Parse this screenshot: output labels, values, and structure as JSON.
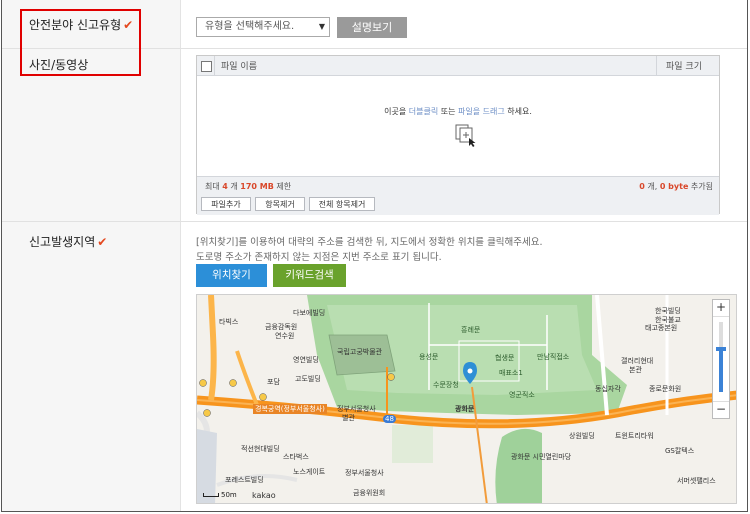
{
  "sections": {
    "category_label": "안전분야 신고유형",
    "media_label": "사진/동영상",
    "location_label": "신고발생지역",
    "required_mark": "✔"
  },
  "category": {
    "select_placeholder": "유형을 선택해주세요.",
    "explain_button": "설명보기"
  },
  "upload": {
    "col_filename": "파일 이름",
    "col_filesize": "파일 크기",
    "drop_text_prefix": "이곳을 ",
    "drop_link1": "더블클릭",
    "drop_mid": " 또는 ",
    "drop_link2": "파일을 드래그",
    "drop_suffix": " 하세요.",
    "limit_prefix": "최대 ",
    "limit_count": "4",
    "limit_mid": " 개 ",
    "limit_size": "170 MB",
    "limit_suffix": " 제한",
    "total_count": "0",
    "total_mid": " 개, ",
    "total_size": "0 byte",
    "total_suffix": " 추가됨",
    "buttons": [
      "파일추가",
      "항목제거",
      "전체 항목제거"
    ]
  },
  "location": {
    "desc1": "[위치찾기]를 이용하여 대략의 주소를 검색한 뒤, 지도에서 정확한 위치를 클릭해주세요.",
    "desc2": "도로명 주소가 존재하지 않는 지점은 지번 주소로 표기 됩니다.",
    "find_button": "위치찾기",
    "keyword_button": "키워드검색"
  },
  "map": {
    "labels": [
      "다보에빌딩",
      "금융감독원",
      "연수원",
      "영연빌딩",
      "고도빌딩",
      "포담",
      "타빅스",
      "경복궁역(정부서울청사)",
      "정부서울청사",
      "별관",
      "적선현대빌딩",
      "스타벅스",
      "노스게이트",
      "정부서울청사",
      "금융위원회",
      "포레스트빌딩",
      "흥례문",
      "용성문",
      "협생문",
      "매표소1",
      "수문장청",
      "광화문",
      "영군직소",
      "한국빌딩",
      "한국불교",
      "태고종본원",
      "갤러리현대",
      "본관",
      "종로문화원",
      "동십자각",
      "상원빌딩",
      "트윈트리타워",
      "GS칼텍스",
      "광화문 시민열린마당",
      "서머셋팰리스",
      "국립고궁박물관",
      "만남직접소"
    ],
    "scale_label": "50m",
    "logo": "kakao",
    "zoom_in": "+",
    "zoom_out": "−",
    "zoom_level": 0.62,
    "road_number": "48"
  }
}
